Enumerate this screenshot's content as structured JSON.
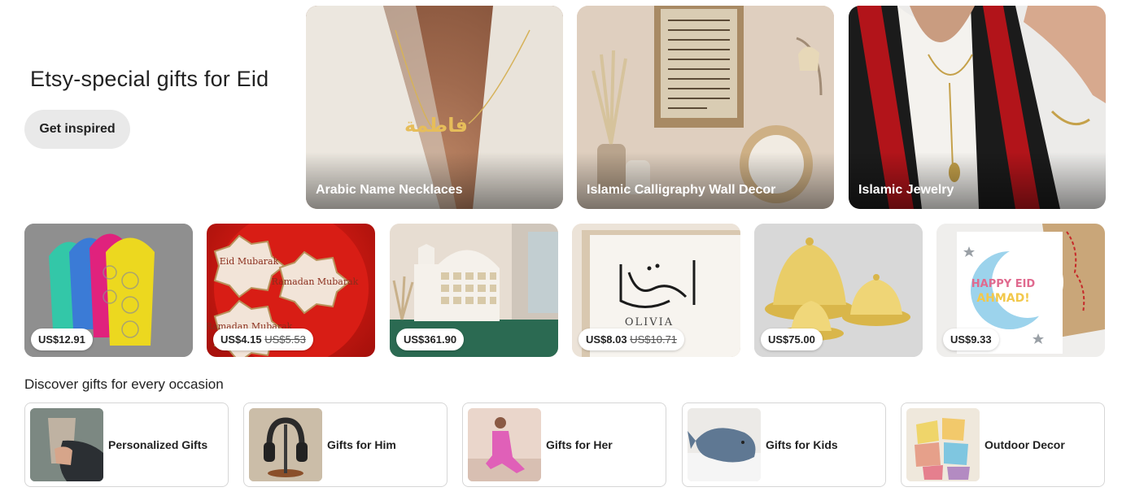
{
  "hero": {
    "title": "Etsy-special gifts for Eid",
    "button_label": "Get inspired"
  },
  "categories": [
    {
      "label": "Arabic Name Necklaces"
    },
    {
      "label": "Islamic Calligraphy Wall Decor"
    },
    {
      "label": "Islamic Jewelry"
    }
  ],
  "necklace_text": "فاطمة",
  "products": [
    {
      "price": "US$12.91",
      "original_price": ""
    },
    {
      "price": "US$4.15",
      "original_price": "US$5.53"
    },
    {
      "price": "US$361.90",
      "original_price": ""
    },
    {
      "price": "US$8.03",
      "original_price": "US$10.71"
    },
    {
      "price": "US$75.00",
      "original_price": ""
    },
    {
      "price": "US$9.33",
      "original_price": ""
    }
  ],
  "stickers": [
    "Eid Mubarak",
    "Ramadan Mubarak",
    "Ramadan Mubarak",
    "Eid Mubarak"
  ],
  "print_name": "OLIVIA",
  "greeting_card": {
    "line1": "HAPPY EID",
    "line2": "AHMAD!"
  },
  "occasions_section": {
    "title": "Discover gifts for every occasion",
    "items": [
      {
        "label": "Personalized Gifts"
      },
      {
        "label": "Gifts for Him"
      },
      {
        "label": "Gifts for Her"
      },
      {
        "label": "Gifts for Kids"
      },
      {
        "label": "Outdoor Decor"
      }
    ]
  },
  "colors": {
    "text": "#222222",
    "button_bg": "#e9e9e9",
    "card_border": "#d6d6d6"
  }
}
